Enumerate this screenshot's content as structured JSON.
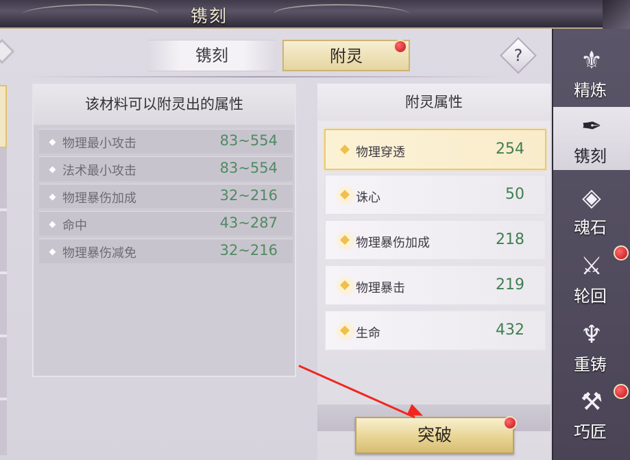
{
  "window": {
    "title": "镌刻"
  },
  "tabs": [
    {
      "label": "镌刻",
      "active": false
    },
    {
      "label": "附灵",
      "active": true
    }
  ],
  "help": {
    "label": "?"
  },
  "material_panel": {
    "header": "该材料可以附灵出的属性",
    "items": [
      {
        "name": "物理最小攻击",
        "range": "83~554"
      },
      {
        "name": "法术最小攻击",
        "range": "83~554"
      },
      {
        "name": "物理暴伤加成",
        "range": "32~216"
      },
      {
        "name": "命中",
        "range": "43~287"
      },
      {
        "name": "物理暴伤减免",
        "range": "32~216"
      }
    ]
  },
  "enchant_panel": {
    "header": "附灵属性",
    "items": [
      {
        "name": "物理穿透",
        "value": "254",
        "selected": true
      },
      {
        "name": "诛心",
        "value": "50",
        "selected": false
      },
      {
        "name": "物理暴伤加成",
        "value": "218",
        "selected": false
      },
      {
        "name": "物理暴击",
        "value": "219",
        "selected": false
      },
      {
        "name": "生命",
        "value": "432",
        "selected": false
      }
    ]
  },
  "breakthrough_button": {
    "label": "突破"
  },
  "sidebar": {
    "items": [
      {
        "label": "精炼",
        "icon": "refine-icon",
        "glyph": "⚜",
        "active": false
      },
      {
        "label": "镌刻",
        "icon": "engrave-icon",
        "glyph": "✒",
        "active": true
      },
      {
        "label": "魂石",
        "icon": "soulstone-icon",
        "glyph": "◈",
        "active": false
      },
      {
        "label": "轮回",
        "icon": "reincarnation-icon",
        "glyph": "⚔",
        "active": false
      },
      {
        "label": "重铸",
        "icon": "recast-icon",
        "glyph": "♆",
        "active": false
      },
      {
        "label": "巧匠",
        "icon": "craftsman-icon",
        "glyph": "⚒",
        "active": false
      }
    ]
  },
  "colors": {
    "accent_gold": "#e6d59f",
    "value_green": "#3f7f52",
    "notification_red": "#c0121a",
    "annotation_arrow": "#f0271f"
  }
}
